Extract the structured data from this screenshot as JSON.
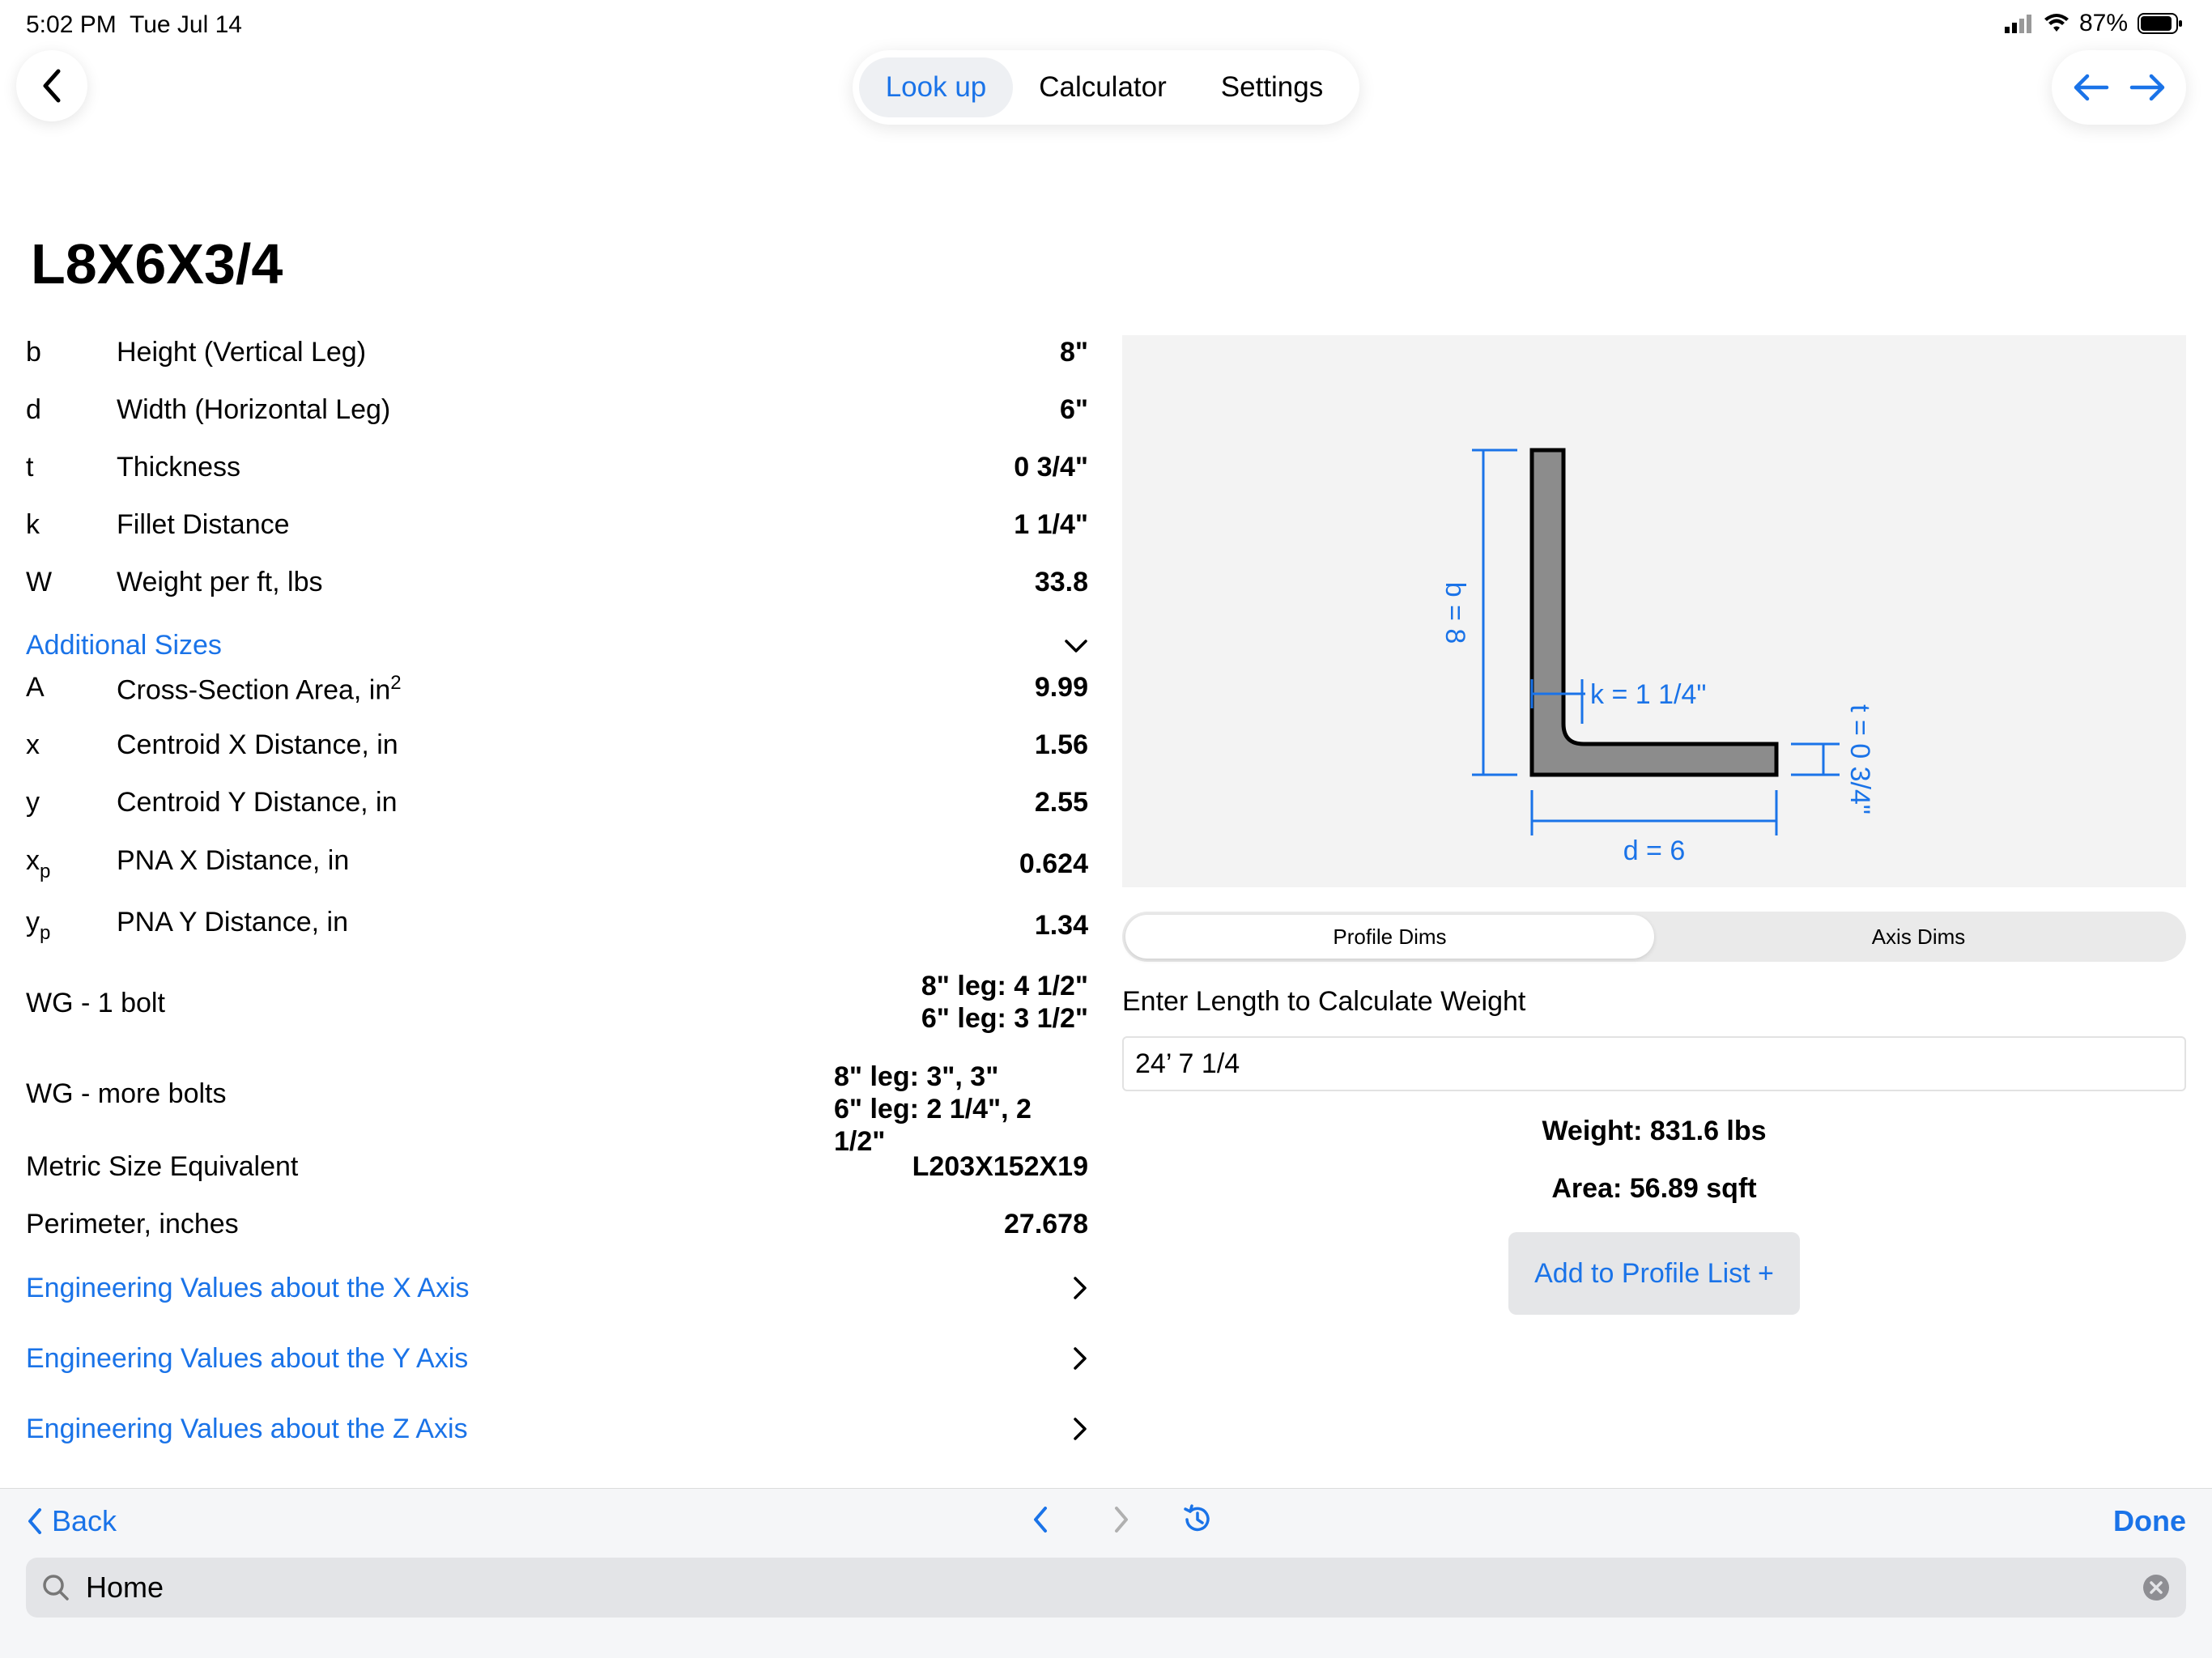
{
  "status": {
    "time": "5:02 PM",
    "date": "Tue Jul 14",
    "battery": "87%"
  },
  "tabs": [
    "Look up",
    "Calculator",
    "Settings"
  ],
  "title": "L8X6X3/4",
  "props": [
    {
      "sym": "b",
      "label": "Height (Vertical Leg)",
      "value": "8\""
    },
    {
      "sym": "d",
      "label": "Width (Horizontal Leg)",
      "value": "6\""
    },
    {
      "sym": "t",
      "label": "Thickness",
      "value": "0 3/4\""
    },
    {
      "sym": "k",
      "label": "Fillet Distance",
      "value": "1 1/4\""
    },
    {
      "sym": "W",
      "label": "Weight per ft, lbs",
      "value": "33.8"
    }
  ],
  "additional_sizes": "Additional Sizes",
  "additional": [
    {
      "sym": "A",
      "label": "Cross-Section Area, in",
      "sup": "2",
      "value": "9.99"
    },
    {
      "sym": "x",
      "label": "Centroid X Distance, in",
      "value": "1.56"
    },
    {
      "sym": "y",
      "label": "Centroid Y Distance, in",
      "value": "2.55"
    },
    {
      "sym": "x",
      "sub": "p",
      "label": "PNA X Distance, in",
      "value": "0.624"
    },
    {
      "sym": "y",
      "sub": "p",
      "label": "PNA Y Distance, in",
      "value": "1.34"
    }
  ],
  "wg1": {
    "label": "WG - 1 bolt",
    "line1": "8\" leg: 4 1/2\"",
    "line2": "6\" leg: 3 1/2\""
  },
  "wgm": {
    "label": "WG - more bolts",
    "line1": "8\" leg: 3\", 3\"",
    "line2": "6\" leg: 2 1/4\", 2 1/2\""
  },
  "metric": {
    "label": "Metric Size Equivalent",
    "value": "L203X152X19"
  },
  "perimeter": {
    "label": "Perimeter, inches",
    "value": "27.678"
  },
  "links": [
    "Engineering Values about the X Axis",
    "Engineering Values about the Y Axis",
    "Engineering Values about the Z Axis"
  ],
  "drawing": {
    "b_label": "b = 8",
    "k_label": "k = 1 1/4\"",
    "t_label": "t = 0 3/4\"",
    "d_label": "d = 6"
  },
  "dims_tabs": [
    "Profile Dims",
    "Axis Dims"
  ],
  "length_label": "Enter Length to Calculate Weight",
  "length_value": "24’ 7 1/4",
  "weight": "Weight: 831.6 lbs",
  "area": "Area: 56.89 sqft",
  "add_button": "Add to Profile List +",
  "toolbar": {
    "back": "Back",
    "done": "Done"
  },
  "search": {
    "value": "Home"
  },
  "colors": {
    "accent": "#1a73e8"
  }
}
